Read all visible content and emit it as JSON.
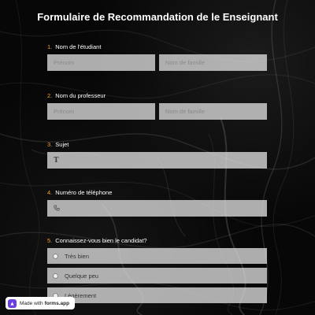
{
  "form": {
    "title": "Formulaire de Recommandation de le Enseignant"
  },
  "questions": [
    {
      "number": "1.",
      "label": "Nom de l'étudiant",
      "first_placeholder": "Prénom",
      "last_placeholder": "Nom de famille"
    },
    {
      "number": "2.",
      "label": "Nom du professeur",
      "first_placeholder": "Prénom",
      "last_placeholder": "Nom de famille"
    },
    {
      "number": "3.",
      "label": "Sujet",
      "icon": "text-icon"
    },
    {
      "number": "4.",
      "label": "Numéro de téléphone",
      "icon": "phone-icon"
    },
    {
      "number": "5.",
      "label": "Connaissez-vous bien le candidat?",
      "options": [
        "Très bien",
        "Quelque peu",
        "Légèrement"
      ]
    }
  ],
  "badge": {
    "prefix": "Made with",
    "brand": "forms.app"
  },
  "colors": {
    "accent": "#f0a030",
    "field_bg": "#dcdcdc",
    "background": "#070707",
    "badge_logo": "#6b3fe0"
  }
}
